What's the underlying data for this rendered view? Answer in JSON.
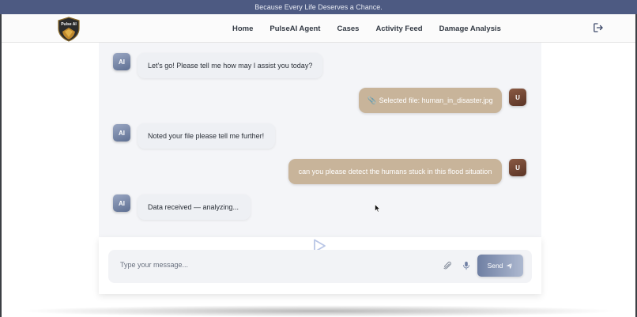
{
  "banner": {
    "text": "Because Every Life Deserves a Chance."
  },
  "brand": {
    "logo_text": "Pulse AI"
  },
  "nav": {
    "items": [
      {
        "label": "Home"
      },
      {
        "label": "PulseAI Agent"
      },
      {
        "label": "Cases"
      },
      {
        "label": "Activity Feed"
      },
      {
        "label": "Damage Analysis"
      }
    ]
  },
  "chat": {
    "ai_initials": "AI",
    "user_initial": "U",
    "messages": [
      {
        "sender": "ai",
        "text": "Let's go! Please tell me how may I assist you today?"
      },
      {
        "sender": "user",
        "text": "Selected file: human_in_disaster.jpg",
        "icon": "paperclip-icon"
      },
      {
        "sender": "ai",
        "text": "Noted your file please tell me further!"
      },
      {
        "sender": "user",
        "text": "can you please detect the humans stuck in this flood situation"
      },
      {
        "sender": "ai",
        "text": "Data received — analyzing..."
      }
    ]
  },
  "composer": {
    "placeholder": "Type your message...",
    "send_label": "Send"
  },
  "colors": {
    "banner": "#4d5a82",
    "ai_avatar": "#7a88a8",
    "user_avatar": "#6e4535",
    "user_bubble": "#c8b49a",
    "send_button": "#8d9bbb"
  }
}
